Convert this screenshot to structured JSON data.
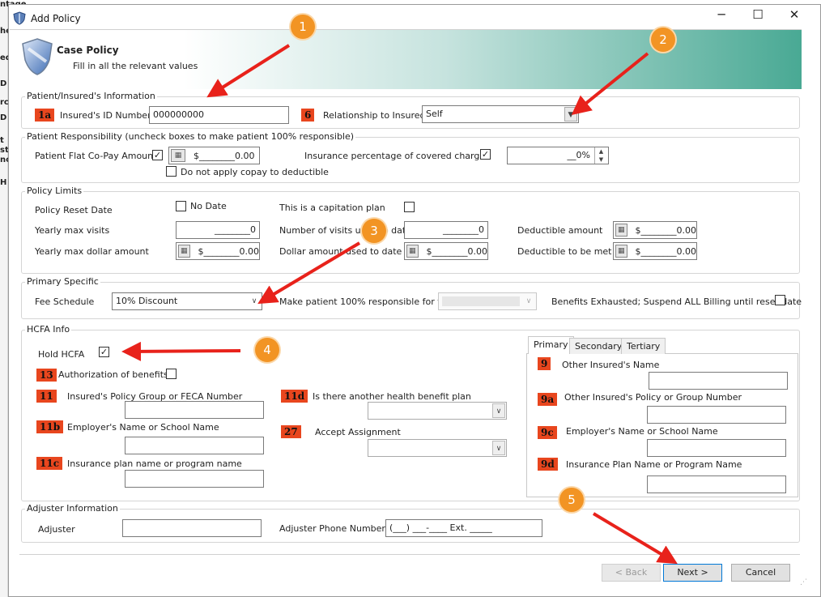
{
  "window": {
    "title": "Add Policy",
    "minimize": "─",
    "maximize": "☐",
    "close": "✕"
  },
  "banner": {
    "title": "Case Policy",
    "subtitle": "Fill in all the relevant values"
  },
  "background_partial_labels": [
    "ntage",
    "he",
    "ed",
    "D",
    "rc",
    "D",
    "t",
    "st",
    "nc",
    "H"
  ],
  "patient_info": {
    "legend": "Patient/Insured's Information",
    "badge_id": "1a",
    "id_label": "Insured's ID Number",
    "id_value": "000000000",
    "badge_rel": "6",
    "rel_label": "Relationship to Insured",
    "rel_value": "Self"
  },
  "responsibility": {
    "legend": "Patient Responsibility (uncheck boxes to make patient 100% responsible)",
    "copay_label": "Patient Flat Co-Pay Amount",
    "copay_checked": "✓",
    "copay_value": "$________0.00",
    "no_copay_label": "Do not apply copay to deductible",
    "ins_pct_label": "Insurance percentage of covered charges",
    "ins_pct_checked": "✓",
    "ins_pct_value": "__0%"
  },
  "limits": {
    "legend": "Policy Limits",
    "reset_label": "Policy Reset Date",
    "no_date_label": "No Date",
    "capitation_label": "This is a capitation plan",
    "yearly_visits_label": "Yearly max visits",
    "yearly_visits_value": "________0",
    "visits_to_date_label": "Number of visits used to date",
    "visits_to_date_value": "________0",
    "deductible_label": "Deductible amount",
    "deductible_value": "$________0.00",
    "yearly_dollar_label": "Yearly max dollar amount",
    "yearly_dollar_value": "$________0.00",
    "dollar_to_date_label": "Dollar amount used to date",
    "dollar_to_date_value": "$________0.00",
    "deductible_met_label": "Deductible to be met",
    "deductible_met_value": "$________0.00"
  },
  "primary_specific": {
    "legend": "Primary Specific",
    "fee_label": "Fee Schedule",
    "fee_value": "10% Discount",
    "responsible_label": "Make patient 100% responsible for the",
    "benefits_label": "Benefits Exhausted; Suspend ALL Billing until reset date"
  },
  "hcfa": {
    "legend": "HCFA Info",
    "hold_label": "Hold HCFA",
    "hold_checked": "✓",
    "badge_13": "13",
    "auth_label": "Authorization of benefits",
    "badge_11": "11",
    "policy_group_label": "Insured's Policy Group or FECA Number",
    "badge_11b": "11b",
    "employer_label": "Employer's Name or School Name",
    "badge_11c": "11c",
    "plan_label": "Insurance plan name or program name",
    "badge_11d": "11d",
    "another_plan_label": "Is there another health benefit plan",
    "badge_27": "27",
    "accept_label": "Accept Assignment",
    "tabs": [
      "Primary",
      "Secondary",
      "Tertiary"
    ],
    "badge_9": "9",
    "other_name_label": "Other Insured's Name",
    "badge_9a": "9a",
    "other_policy_label": "Other Insured's Policy or Group Number",
    "badge_9c": "9c",
    "other_employer_label": "Employer's Name or School Name",
    "badge_9d": "9d",
    "other_plan_label": "Insurance Plan Name or Program Name"
  },
  "adjuster": {
    "legend": "Adjuster Information",
    "adjuster_label": "Adjuster",
    "phone_label": "Adjuster Phone Number",
    "phone_value": "(___) ___-____ Ext. _____"
  },
  "footer": {
    "back": "< Back",
    "next": "Next >",
    "cancel": "Cancel"
  },
  "callouts": [
    "1",
    "2",
    "3",
    "4",
    "5"
  ],
  "colors": {
    "callout": "#f29424",
    "arrow": "#e8221b",
    "badge": "#e8461e",
    "banner_end": "#49a994"
  }
}
